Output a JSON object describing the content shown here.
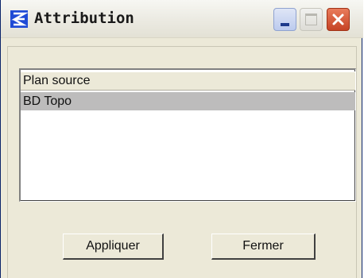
{
  "window": {
    "title": "Attribution",
    "icon": "app-logo-icon",
    "controls": [
      "minimize-icon",
      "maximize-icon",
      "close-icon"
    ]
  },
  "list": {
    "column_header": "Plan source",
    "rows": [
      "BD Topo"
    ],
    "selected_row": "BD Topo"
  },
  "buttons": {
    "apply_label": "Appliquer",
    "close_label": "Fermer"
  },
  "colors": {
    "selection": "#bdbcbc",
    "close_button": "#c64325",
    "dialog_face": "#ece9d8"
  }
}
